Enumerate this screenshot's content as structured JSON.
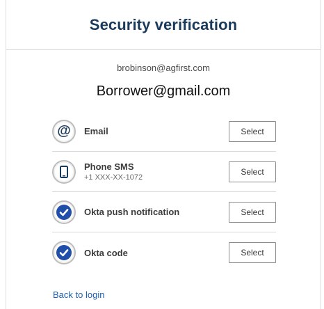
{
  "header": {
    "title": "Security verification"
  },
  "identity": {
    "username": "brobinson@agfirst.com",
    "overlay_email": "Borrower@gmail.com"
  },
  "factors": [
    {
      "label": "Email",
      "sublabel": "",
      "icon": "at-sign-icon",
      "button": "Select"
    },
    {
      "label": "Phone SMS",
      "sublabel": "+1 XXX-XX-1072",
      "icon": "phone-icon",
      "button": "Select"
    },
    {
      "label": "Okta push notification",
      "sublabel": "",
      "icon": "okta-check-icon",
      "button": "Select"
    },
    {
      "label": "Okta code",
      "sublabel": "",
      "icon": "okta-check-icon",
      "button": "Select"
    }
  ],
  "footer": {
    "back_link": "Back to login"
  },
  "colors": {
    "title": "#1a3a5c",
    "link": "#1d5fb0",
    "okta_blue": "#1f4fa8"
  }
}
